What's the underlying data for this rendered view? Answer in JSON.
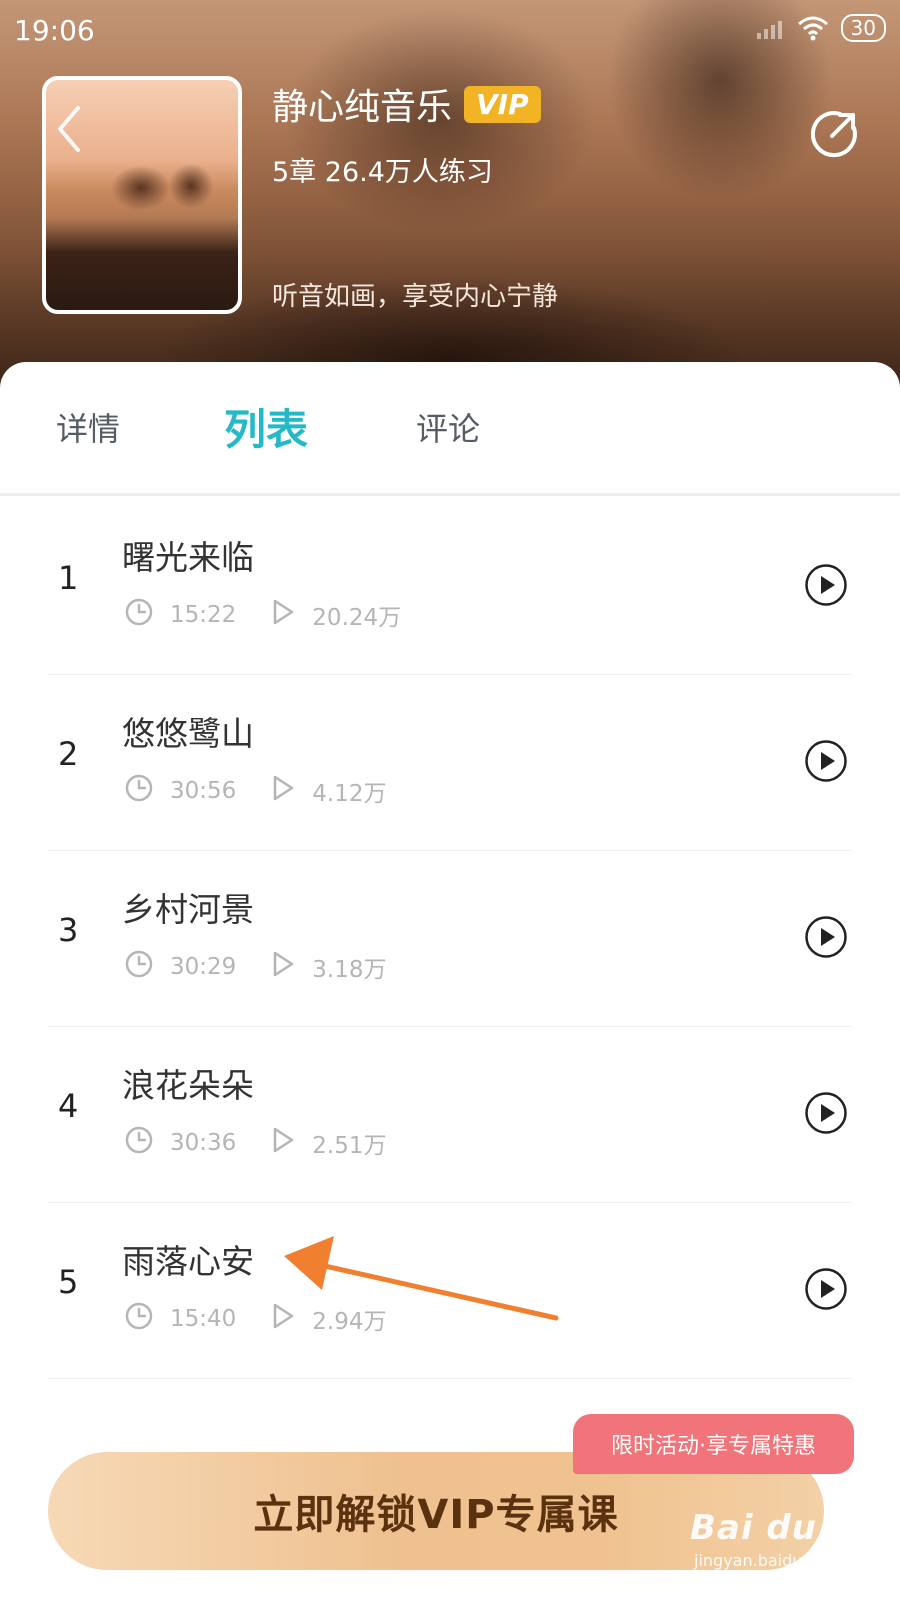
{
  "status_bar": {
    "time": "19:06",
    "battery": "30"
  },
  "course": {
    "title": "静心纯音乐",
    "badge": "VIP",
    "meta": "5章 26.4万人练习",
    "slogan": "听音如画，享受内心宁静"
  },
  "tabs": [
    {
      "label": "详情",
      "active": false
    },
    {
      "label": "列表",
      "active": true
    },
    {
      "label": "评论",
      "active": false
    }
  ],
  "tracks": [
    {
      "index": "1",
      "title": "曙光来临",
      "duration": "15:22",
      "plays": "20.24万"
    },
    {
      "index": "2",
      "title": "悠悠鹭山",
      "duration": "30:56",
      "plays": "4.12万"
    },
    {
      "index": "3",
      "title": "乡村河景",
      "duration": "30:29",
      "plays": "3.18万"
    },
    {
      "index": "4",
      "title": "浪花朵朵",
      "duration": "30:36",
      "plays": "2.51万"
    },
    {
      "index": "5",
      "title": "雨落心安",
      "duration": "15:40",
      "plays": "2.94万"
    }
  ],
  "cta": {
    "label": "立即解锁VIP专属课",
    "promo": "限时活动·享专属特惠"
  },
  "watermark": {
    "logo": "Bai du 经验",
    "url": "jingyan.baidu.com"
  },
  "colors": {
    "accent": "#25b9c8",
    "vip_badge": "#f2b324",
    "promo": "#f07479",
    "annotation_arrow": "#f07f2f"
  }
}
